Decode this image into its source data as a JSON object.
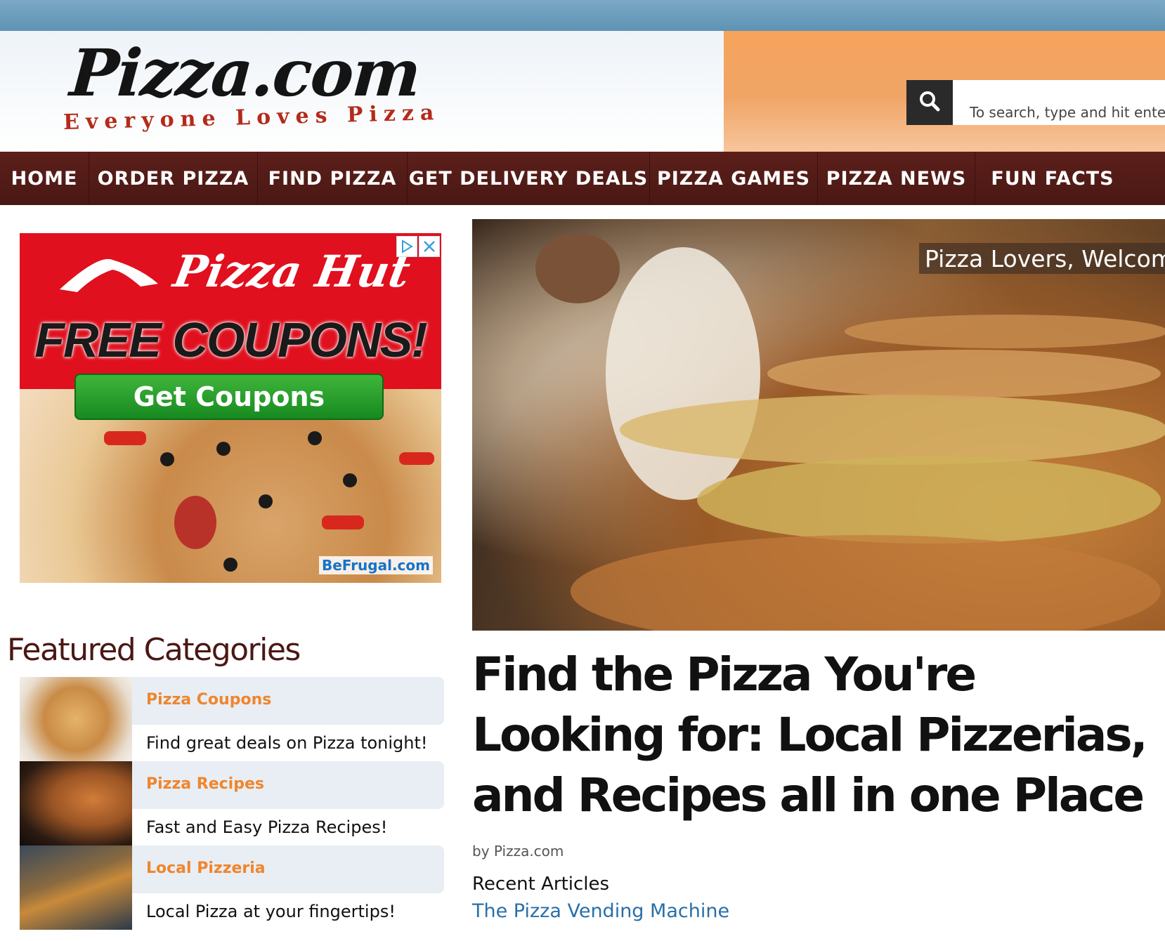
{
  "header": {
    "logo_title": "Pizza.com",
    "logo_tagline": "Everyone Loves Pizza",
    "search_placeholder": "To search, type and hit enter",
    "search_icon": "search-icon"
  },
  "nav": {
    "items": [
      {
        "label": "HOME"
      },
      {
        "label": "ORDER PIZZA"
      },
      {
        "label": "FIND PIZZA"
      },
      {
        "label": "GET DELIVERY DEALS"
      },
      {
        "label": "PIZZA GAMES"
      },
      {
        "label": "PIZZA NEWS"
      },
      {
        "label": "FUN FACTS"
      }
    ]
  },
  "ad": {
    "brand": "Pizza Hut",
    "headline": "FREE COUPONS!",
    "button_label": "Get Coupons",
    "source": "BeFrugal.com",
    "choices_icon": "ad-choices-icon",
    "close_icon": "close-icon"
  },
  "hero": {
    "caption": "Pizza Lovers, Welcome"
  },
  "featured": {
    "title": "Featured Categories",
    "categories": [
      {
        "title": "Pizza Coupons",
        "description": "Find great deals on Pizza tonight!"
      },
      {
        "title": "Pizza Recipes",
        "description": "Fast and Easy Pizza Recipes!"
      },
      {
        "title": "Local Pizzeria",
        "description": "Local Pizza at your fingertips!"
      }
    ]
  },
  "article": {
    "heading": "Find the Pizza You're Looking for: Local Pizzerias, and Recipes all in one Place",
    "byline": "by Pizza.com",
    "recent_label": "Recent Articles",
    "recent_link": "The Pizza Vending Machine"
  },
  "colors": {
    "nav_bg": "#5c1f1a",
    "accent_orange": "#f0852d",
    "link_blue": "#2a6fa8",
    "ad_red": "#e0101e"
  }
}
